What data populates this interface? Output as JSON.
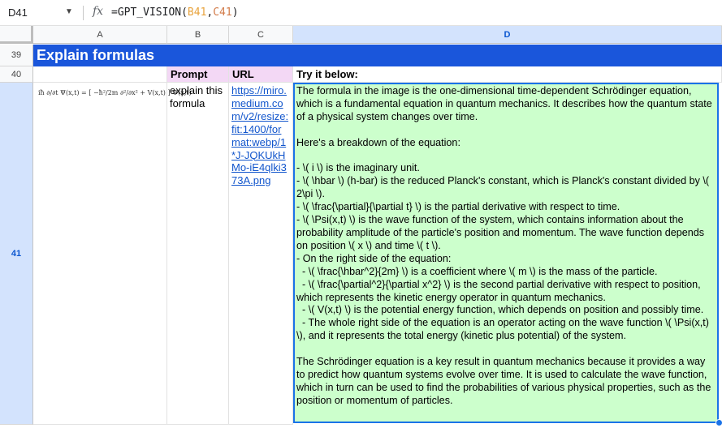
{
  "formula_bar": {
    "cell_ref": "D41",
    "formula_prefix": "=GPT_VISION(",
    "arg1": "B41",
    "comma": ",",
    "arg2": "C41",
    "formula_suffix": ")"
  },
  "columns": [
    "A",
    "B",
    "C",
    "D"
  ],
  "rows": [
    "39",
    "40",
    "41"
  ],
  "title": "Explain formulas",
  "headers": {
    "b": "Prompt",
    "c": "URL",
    "d": "Try it below:"
  },
  "row41": {
    "formula_image_text": "iħ ∂/∂t Ψ(x,t) = [ −ħ²/2m ∂²/∂x² + V(x,t) ] Ψ(x,t)",
    "prompt": "explain this formula",
    "url": "https://miro.medium.com/v2/resize:fit:1400/format:webp/1*J-JQKUkHMo-iE4qlki373A.png",
    "answer": "The formula in the image is the one-dimensional time-dependent Schrödinger equation, which is a fundamental equation in quantum mechanics. It describes how the quantum state of a physical system changes over time.\n\nHere's a breakdown of the equation:\n\n- \\( i \\) is the imaginary unit.\n- \\( \\hbar \\) (h-bar) is the reduced Planck's constant, which is Planck's constant divided by \\( 2\\pi \\).\n- \\( \\frac{\\partial}{\\partial t} \\) is the partial derivative with respect to time.\n- \\( \\Psi(x,t) \\) is the wave function of the system, which contains information about the probability amplitude of the particle's position and momentum. The wave function depends on position \\( x \\) and time \\( t \\).\n- On the right side of the equation:\n  - \\( \\frac{\\hbar^2}{2m} \\) is a coefficient where \\( m \\) is the mass of the particle.\n  - \\( \\frac{\\partial^2}{\\partial x^2} \\) is the second partial derivative with respect to position, which represents the kinetic energy operator in quantum mechanics.\n  - \\( V(x,t) \\) is the potential energy function, which depends on position and possibly time.\n  - The whole right side of the equation is an operator acting on the wave function \\( \\Psi(x,t) \\), and it represents the total energy (kinetic plus potential) of the system.\n\nThe Schrödinger equation is a key result in quantum mechanics because it provides a way to predict how quantum systems evolve over time. It is used to calculate the wave function, which in turn can be used to find the probabilities of various physical properties, such as the position or momentum of particles."
  },
  "colors": {
    "title_bg": "#1a56db",
    "header_bg": "#f3d8f5",
    "answer_bg": "#ccffcc",
    "selection": "#1a73e8"
  }
}
